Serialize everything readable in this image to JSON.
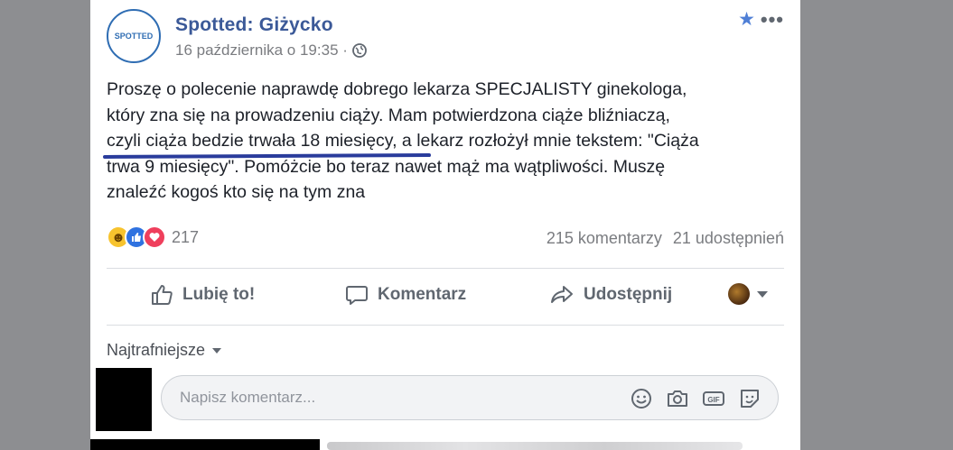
{
  "post": {
    "page_name": "Spotted: Giżycko",
    "avatar_text": "SPOTTED",
    "date": "16 października o 19:35 ·",
    "text_lines": [
      "Proszę o polecenie naprawdę dobrego lekarza SPECJALISTY ginekologa,",
      "który zna się na prowadzeniu ciąży. Mam potwierdzona ciąże bliźniaczą,",
      "czyli ciąża bedzie trwała 18 miesięcy, a lekarz rozłożył mnie tekstem: \"Ciąża",
      "trwa 9 miesięcy\". Pomóżcie bo teraz nawet mąż ma wątpliwości. Muszę",
      "znaleźć kogoś kto się na tym zna"
    ]
  },
  "stats": {
    "reaction_count": "217",
    "comments": "215 komentarzy",
    "shares": "21 udostępnień"
  },
  "actions": {
    "like": "Lubię to!",
    "comment": "Komentarz",
    "share": "Udostępnij"
  },
  "comments": {
    "sort_label": "Najtrafniejsze",
    "placeholder": "Napisz komentarz..."
  },
  "icons": [
    "star-icon",
    "more-icon",
    "globe-icon",
    "like-icon",
    "comment-icon",
    "share-icon",
    "emoji-icon",
    "camera-icon",
    "gif-icon",
    "sticker-icon"
  ],
  "colors": {
    "brand": "#3b5998",
    "text": "#1d2129",
    "muted": "#7a7c80",
    "underline": "#2a3c9c",
    "like_reaction": "#2f72e0",
    "love_reaction": "#ef3f5c",
    "haha_reaction": "#f7c32e"
  }
}
